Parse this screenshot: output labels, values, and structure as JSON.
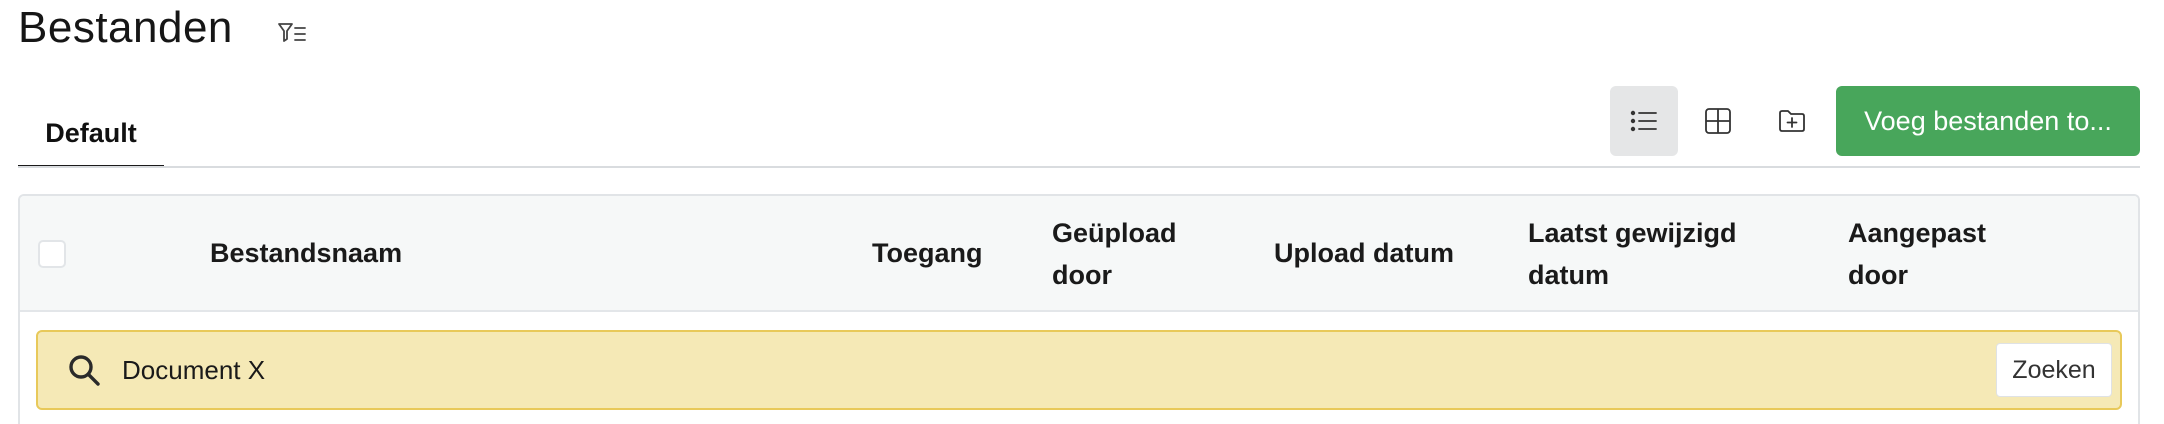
{
  "page": {
    "title": "Bestanden",
    "filter_icon": "filter-list-icon"
  },
  "tabs": [
    {
      "label": "Default",
      "active": true
    }
  ],
  "toolbar": {
    "view_list_icon": "list-view-icon",
    "view_grid_icon": "grid-view-icon",
    "new_folder_icon": "folder-plus-icon",
    "add_files_label": "Voeg bestanden to...",
    "accent_color": "#48a65b"
  },
  "table": {
    "columns": [
      {
        "key": "name",
        "label": "Bestandsnaam"
      },
      {
        "key": "access",
        "label": "Toegang"
      },
      {
        "key": "uploaded_by",
        "label": "Geüpload door"
      },
      {
        "key": "upload_date",
        "label": "Upload datum"
      },
      {
        "key": "modified_date",
        "label": "Laatst gewijzigd datum"
      },
      {
        "key": "modified_by",
        "label": "Aangepast door"
      }
    ]
  },
  "search": {
    "value": "Document X",
    "button_label": "Zoeken",
    "icon": "search-icon",
    "highlight_color": "#f5e9b6"
  }
}
